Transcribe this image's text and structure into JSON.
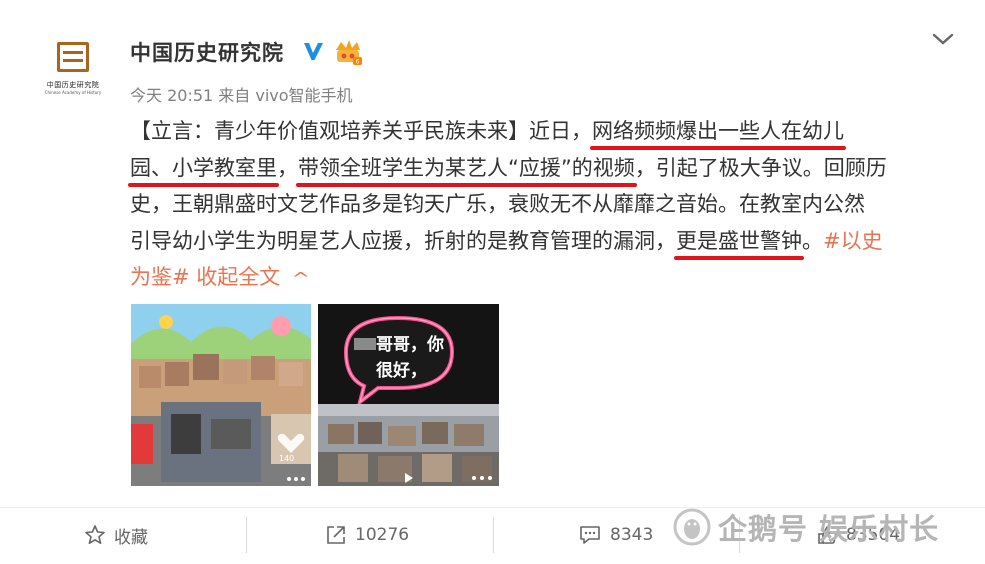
{
  "account": {
    "name": "中国历史研究院",
    "avatar_text_cn": "中国历史研究院",
    "avatar_text_en": "Chinese Academy of History",
    "verified_icon": "verified-badge-icon",
    "vip_icon": "crown-vip-icon"
  },
  "post": {
    "meta": "今天 20:51 来自 vivo智能手机",
    "lines": [
      [
        "【立言：青少年价值观培养关乎民族未来】近日，",
        "网络频频爆出一些人在幼儿"
      ],
      [
        "园、小学教室里",
        "，",
        "带领全班学生为某艺人“应援”的视频",
        "，引起了极大争议。回顾历"
      ],
      [
        "史，王朝鼎盛时文艺作品多是钧天广乐，衰败无不从靡靡之音始。在教室内公然"
      ],
      [
        "引导幼小学生为明星艺人应援，折射的是教育管理的漏洞，",
        "更是盛世警钟",
        "。",
        "#以史"
      ],
      [
        "为鉴#",
        " ",
        "收起全文"
      ]
    ],
    "underline_color": "#e0141a",
    "link_color": "#eb7350",
    "image2_caption": "哥哥，你\n很好，",
    "image1_counter": "140"
  },
  "actions": {
    "favorite_label": "收藏",
    "repost_count": "10276",
    "comment_count": "8343",
    "like_count": "83504"
  },
  "watermark": "企鹅号 娱乐村长"
}
